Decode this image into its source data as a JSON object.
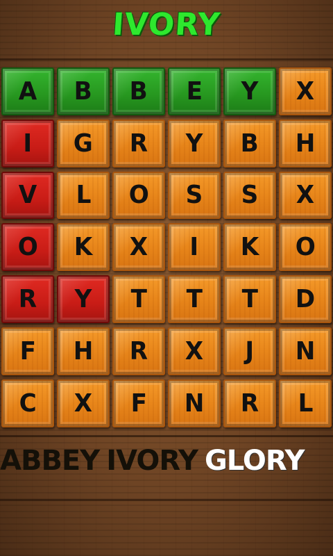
{
  "current_word": "IVORY",
  "colors": {
    "title": "#2ee82e",
    "tile_default": "#e8861a",
    "tile_found": "#26961f",
    "tile_selected": "#c81c16",
    "found_word_text": "#141008",
    "remaining_word_text": "#ffffff"
  },
  "grid": {
    "rows": [
      [
        {
          "l": "A",
          "s": "green"
        },
        {
          "l": "B",
          "s": "green"
        },
        {
          "l": "B",
          "s": "green"
        },
        {
          "l": "E",
          "s": "green"
        },
        {
          "l": "Y",
          "s": "green"
        },
        {
          "l": "X",
          "s": "orange"
        }
      ],
      [
        {
          "l": "I",
          "s": "red"
        },
        {
          "l": "G",
          "s": "orange"
        },
        {
          "l": "R",
          "s": "orange"
        },
        {
          "l": "Y",
          "s": "orange"
        },
        {
          "l": "B",
          "s": "orange"
        },
        {
          "l": "H",
          "s": "orange"
        }
      ],
      [
        {
          "l": "V",
          "s": "red"
        },
        {
          "l": "L",
          "s": "orange"
        },
        {
          "l": "O",
          "s": "orange"
        },
        {
          "l": "S",
          "s": "orange"
        },
        {
          "l": "S",
          "s": "orange"
        },
        {
          "l": "X",
          "s": "orange"
        }
      ],
      [
        {
          "l": "O",
          "s": "red"
        },
        {
          "l": "K",
          "s": "orange"
        },
        {
          "l": "X",
          "s": "orange"
        },
        {
          "l": "I",
          "s": "orange"
        },
        {
          "l": "K",
          "s": "orange"
        },
        {
          "l": "O",
          "s": "orange"
        }
      ],
      [
        {
          "l": "R",
          "s": "red"
        },
        {
          "l": "Y",
          "s": "red"
        },
        {
          "l": "T",
          "s": "orange"
        },
        {
          "l": "T",
          "s": "orange"
        },
        {
          "l": "T",
          "s": "orange"
        },
        {
          "l": "D",
          "s": "orange"
        }
      ],
      [
        {
          "l": "F",
          "s": "orange"
        },
        {
          "l": "H",
          "s": "orange"
        },
        {
          "l": "R",
          "s": "orange"
        },
        {
          "l": "X",
          "s": "orange"
        },
        {
          "l": "J",
          "s": "orange"
        },
        {
          "l": "N",
          "s": "orange"
        }
      ],
      [
        {
          "l": "C",
          "s": "orange"
        },
        {
          "l": "X",
          "s": "orange"
        },
        {
          "l": "F",
          "s": "orange"
        },
        {
          "l": "N",
          "s": "orange"
        },
        {
          "l": "R",
          "s": "orange"
        },
        {
          "l": "L",
          "s": "orange"
        }
      ]
    ]
  },
  "word_list": [
    {
      "word": "ABBEY",
      "state": "found"
    },
    {
      "word": "IVORY",
      "state": "found"
    },
    {
      "word": "GLORY",
      "state": "remaining"
    }
  ]
}
